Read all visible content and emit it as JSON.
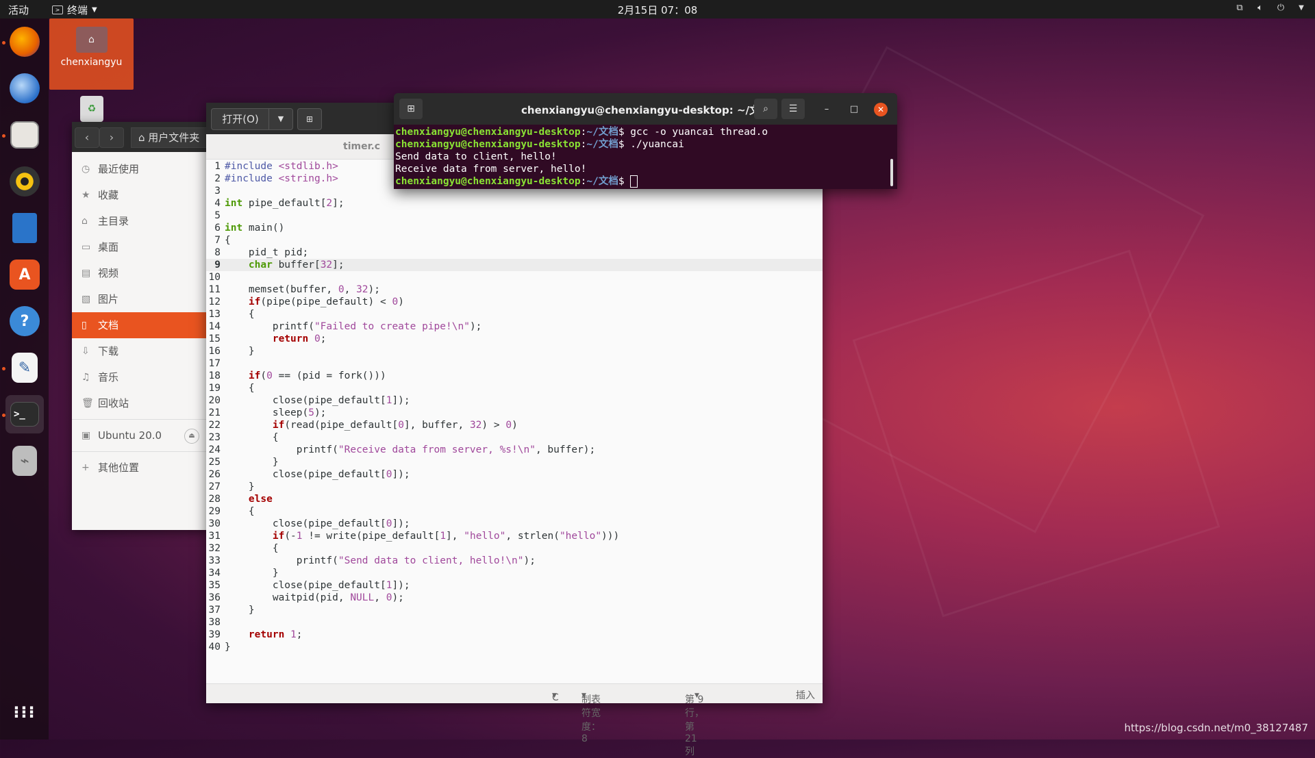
{
  "topbar": {
    "activities": "活动",
    "app_name": "终端",
    "clock": "2月15日  07：08"
  },
  "dock": {
    "items": [
      "firefox-icon",
      "thunderbird-icon",
      "files-icon",
      "rhythmbox-icon",
      "writer-icon",
      "software-icon",
      "help-icon",
      "text-editor-icon",
      "terminal-icon",
      "usb-drive-icon"
    ],
    "show_apps": "show-apps-icon"
  },
  "desktop": {
    "home_label": "chenxiangyu"
  },
  "files": {
    "breadcrumb": "用户文件夹",
    "sidebar": [
      {
        "icon": "clock-icon",
        "label": "最近使用"
      },
      {
        "icon": "star-icon",
        "label": "收藏"
      },
      {
        "icon": "home-icon",
        "label": "主目录"
      },
      {
        "icon": "desktop-icon",
        "label": "桌面"
      },
      {
        "icon": "video-icon",
        "label": "视频"
      },
      {
        "icon": "image-icon",
        "label": "图片"
      },
      {
        "icon": "document-icon",
        "label": "文档"
      },
      {
        "icon": "download-icon",
        "label": "下载"
      },
      {
        "icon": "music-icon",
        "label": "音乐"
      },
      {
        "icon": "trash-icon",
        "label": "回收站"
      }
    ],
    "drive": "Ubuntu 20.0",
    "other": "其他位置"
  },
  "editor": {
    "open_label": "打开(O)",
    "tab_name": "timer.c",
    "code": [
      "#include <stdlib.h>",
      "#include <string.h>",
      "",
      "int pipe_default[2];",
      "",
      "int main()",
      "{",
      "    pid_t pid;",
      "    char buffer[32];",
      "",
      "    memset(buffer, 0, 32);",
      "    if(pipe(pipe_default) < 0)",
      "    {",
      "        printf(\"Failed to create pipe!\\n\");",
      "        return 0;",
      "    }",
      "",
      "    if(0 == (pid = fork()))",
      "    {",
      "        close(pipe_default[1]);",
      "        sleep(5);",
      "        if(read(pipe_default[0], buffer, 32) > 0)",
      "        {",
      "            printf(\"Receive data from server, %s!\\n\", buffer);",
      "        }",
      "        close(pipe_default[0]);",
      "    }",
      "    else",
      "    {",
      "        close(pipe_default[0]);",
      "        if(-1 != write(pipe_default[1], \"hello\", strlen(\"hello\")))",
      "        {",
      "            printf(\"Send data to client, hello!\\n\");",
      "        }",
      "        close(pipe_default[1]);",
      "        waitpid(pid, NULL, 0);",
      "    }",
      "",
      "    return 1;",
      "}"
    ],
    "current_line": 9,
    "status": {
      "language": "C",
      "tab_width": "制表符宽度：8",
      "position": "第 9 行，第 21 列",
      "mode": "插入"
    }
  },
  "terminal": {
    "title": "chenxiangyu@chenxiangyu-desktop: ~/文档",
    "prompt_user": "chenxiangyu@chenxiangyu-desktop",
    "prompt_path": "~/文档",
    "lines": [
      {
        "prompt": true,
        "cmd": "gcc -o yuancai thread.o"
      },
      {
        "prompt": true,
        "cmd": "./yuancai"
      },
      {
        "prompt": false,
        "text": "Send data to client, hello!"
      },
      {
        "prompt": false,
        "text": "Receive data from server, hello!"
      },
      {
        "prompt": true,
        "cmd": ""
      }
    ]
  },
  "watermark": "https://blog.csdn.net/m0_38127487"
}
